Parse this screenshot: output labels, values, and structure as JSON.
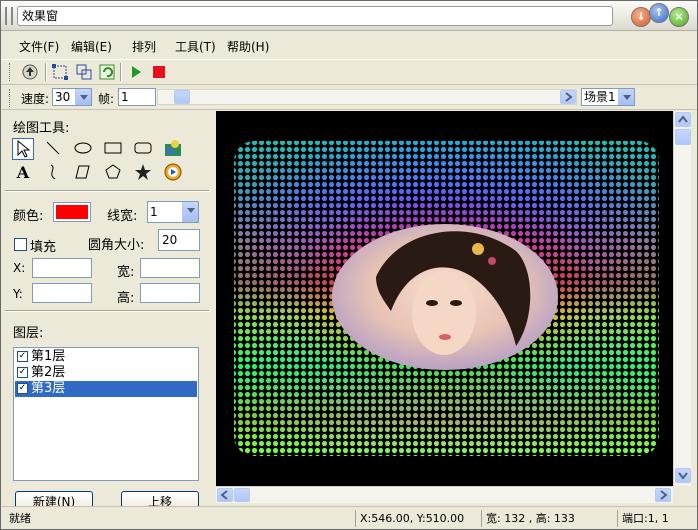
{
  "window": {
    "title": "效果窗"
  },
  "menu": [
    "文件(F)",
    "编辑(E)",
    "排列",
    "工具(T)",
    "帮助(H)"
  ],
  "toolbar": {
    "icons": [
      "up-arrow-icon",
      "select-frame-icon",
      "group-icon",
      "refresh-icon",
      "play-icon",
      "stop-icon"
    ]
  },
  "speedbar": {
    "speed_label": "速度:",
    "speed_value": "30",
    "frame_label": "帧:",
    "frame_value": "1",
    "scene_value": "场景1"
  },
  "draw_tools": {
    "title": "绘图工具:",
    "row1": [
      "pointer-icon",
      "line-icon",
      "ellipse-icon",
      "rectangle-icon",
      "rounded-rectangle-icon",
      "image-icon"
    ],
    "row2_text": "A",
    "row2": [
      "curve-icon",
      "parallelogram-icon",
      "pentagon-icon",
      "star-icon",
      "media-icon"
    ]
  },
  "properties": {
    "color_label": "颜色:",
    "color_value": "#ff0000",
    "line_width_label": "线宽:",
    "line_width_value": "1",
    "fill_label": "填充",
    "radius_label": "圆角大小:",
    "radius_value": "20",
    "x_label": "X:",
    "y_label": "Y:",
    "width_label": "宽:",
    "height_label": "高:"
  },
  "layers": {
    "title": "图层:",
    "items": [
      {
        "label": "第1层",
        "checked": true,
        "selected": false
      },
      {
        "label": "第2层",
        "checked": true,
        "selected": false
      },
      {
        "label": "第3层",
        "checked": true,
        "selected": true
      }
    ],
    "new_button": "新建(N)",
    "up_button": "上移"
  },
  "status": {
    "text": "就绪",
    "coords": "X:546.00, Y:510.00",
    "size": "宽: 132 , 高: 133",
    "port": "端口:1, 1"
  },
  "colors": {
    "accent": "#316ac5",
    "swatch": "#ff0000"
  }
}
